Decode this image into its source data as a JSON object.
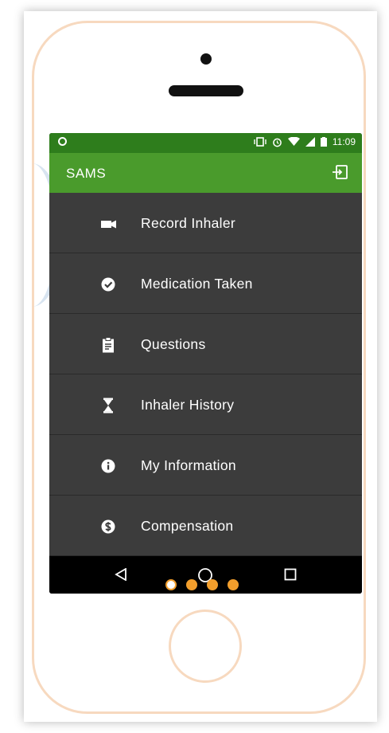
{
  "status_bar": {
    "time": "11:09",
    "icons": [
      "vibrate-icon",
      "alarm-icon",
      "wifi-icon",
      "signal-icon",
      "battery-icon"
    ]
  },
  "app_bar": {
    "title": "SAMS",
    "logout_icon": "logout-icon"
  },
  "menu": {
    "items": [
      {
        "label": "Record Inhaler",
        "icon": "video-camera-icon"
      },
      {
        "label": "Medication Taken",
        "icon": "check-circle-icon"
      },
      {
        "label": "Questions",
        "icon": "clipboard-icon"
      },
      {
        "label": "Inhaler History",
        "icon": "hourglass-icon"
      },
      {
        "label": "My Information",
        "icon": "info-icon"
      },
      {
        "label": "Compensation",
        "icon": "dollar-circle-icon"
      }
    ]
  },
  "nav_bar": {
    "buttons": [
      "back-icon",
      "home-icon",
      "recents-icon"
    ]
  },
  "pager": {
    "count": 4,
    "active_index": 0
  },
  "colors": {
    "status_bar": "#2e7d1c",
    "app_bar": "#4a9b2c",
    "menu_bg": "#3c3c3c",
    "pager_dot": "#f29e2c"
  }
}
